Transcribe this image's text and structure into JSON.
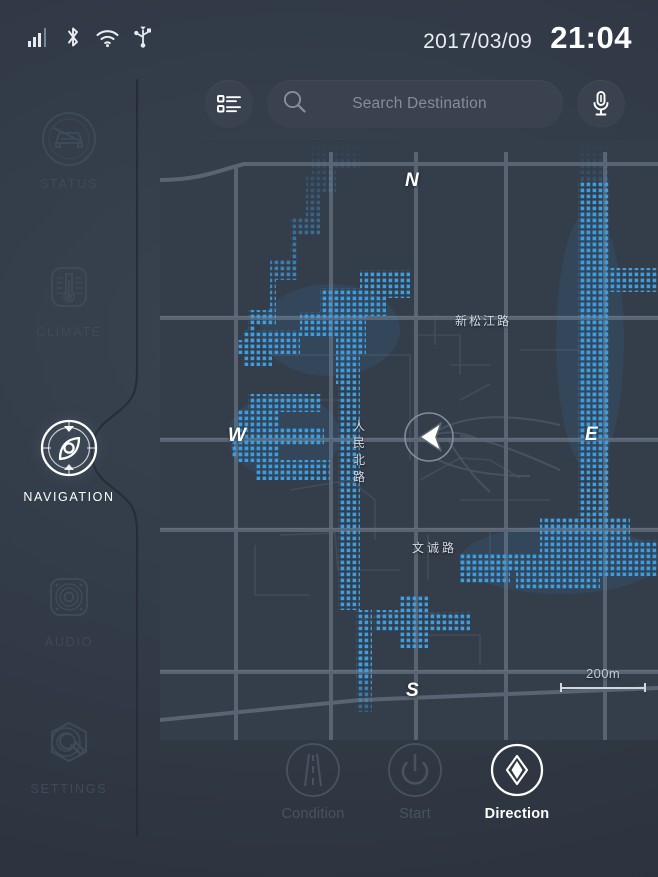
{
  "statusbar": {
    "icons": [
      {
        "name": "cellular-signal-icon"
      },
      {
        "name": "bluetooth-icon"
      },
      {
        "name": "wifi-icon"
      },
      {
        "name": "usb-icon"
      }
    ],
    "date": "2017/03/09",
    "time": "21:04"
  },
  "sidebar": {
    "items": [
      {
        "label": "STATUS",
        "icon": "car-status-icon",
        "active": false
      },
      {
        "label": "CLIMATE",
        "icon": "thermometer-icon",
        "active": false
      },
      {
        "label": "NAVIGATION",
        "icon": "compass-icon",
        "active": true
      },
      {
        "label": "AUDIO",
        "icon": "speaker-icon",
        "active": false
      },
      {
        "label": "SETTINGS",
        "icon": "wrench-icon",
        "active": false
      }
    ]
  },
  "search": {
    "list_button": "list-menu-icon",
    "search_icon": "search-icon",
    "placeholder": "Search Destination",
    "value": "",
    "mic_button": "microphone-icon"
  },
  "map": {
    "compass": {
      "north": "N",
      "west": "W",
      "east": "E",
      "south": "S"
    },
    "street_labels": [
      {
        "text": "新松江路",
        "orientation": "horizontal"
      },
      {
        "text": "人民北路",
        "orientation": "vertical"
      },
      {
        "text": "文诚路",
        "orientation": "horizontal"
      }
    ],
    "scale": "200m",
    "vehicle_marker": "vehicle-heading-arrow"
  },
  "controls": [
    {
      "label": "Condition",
      "icon": "road-icon",
      "active": false
    },
    {
      "label": "Start",
      "icon": "power-icon",
      "active": false
    },
    {
      "label": "Direction",
      "icon": "direction-icon",
      "active": true
    }
  ],
  "colors": {
    "background": "#2f3743",
    "panel": "#39424e",
    "accent_blue": "#3d9ee0",
    "text_primary": "#ffffff",
    "text_muted": "#848e9b",
    "inactive": "#3f4a58"
  }
}
